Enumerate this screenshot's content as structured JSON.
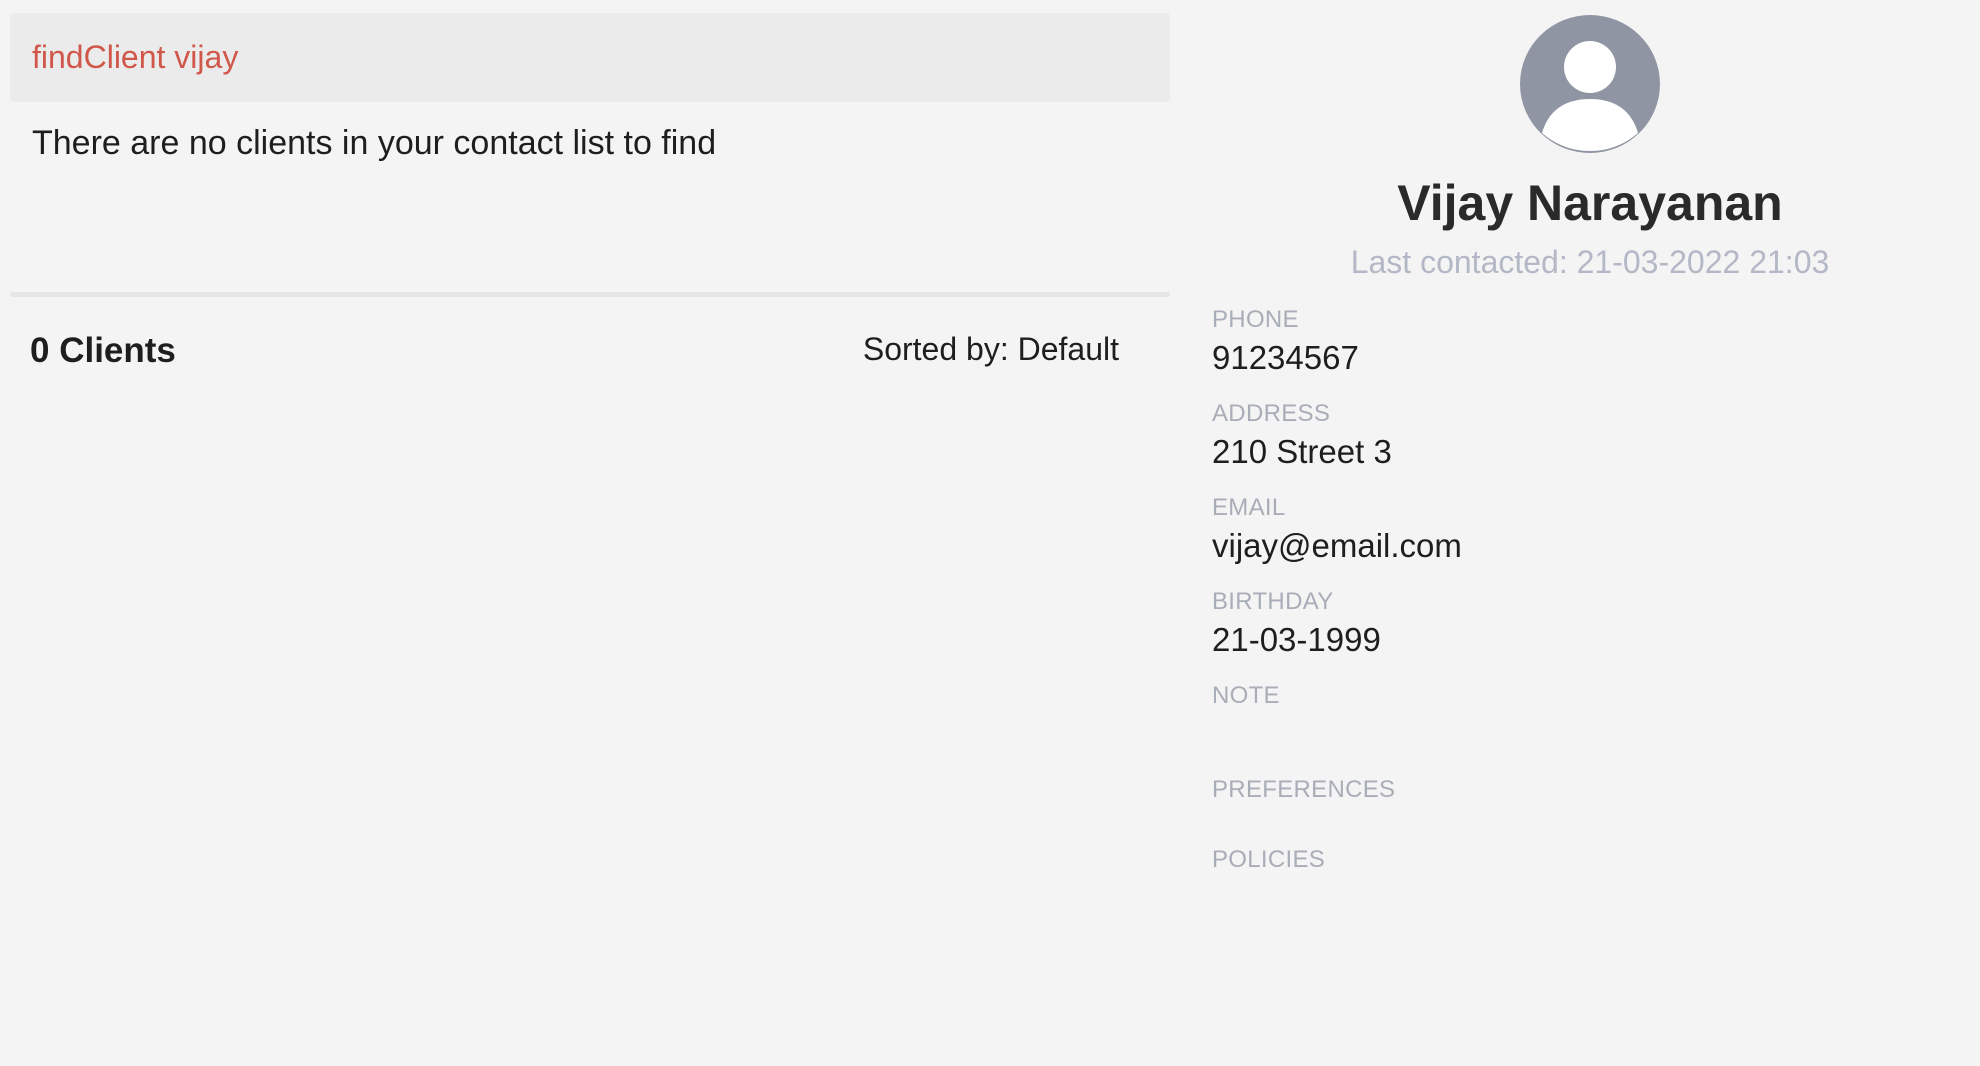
{
  "command": {
    "text": "findClient vijay"
  },
  "result": {
    "message": "There are no clients in your contact list to find"
  },
  "list": {
    "count_label": "0 Clients",
    "sort_label": "Sorted by: Default"
  },
  "profile": {
    "name": "Vijay Narayanan",
    "last_contacted": "Last contacted: 21-03-2022 21:03",
    "fields": [
      {
        "label": "PHONE",
        "value": "91234567"
      },
      {
        "label": "ADDRESS",
        "value": "210 Street 3"
      },
      {
        "label": "EMAIL",
        "value": "vijay@email.com"
      },
      {
        "label": "BIRTHDAY",
        "value": "21-03-1999"
      },
      {
        "label": "NOTE",
        "value": ""
      },
      {
        "label": "PREFERENCES",
        "value": ""
      },
      {
        "label": "POLICIES",
        "value": ""
      }
    ],
    "avatar_icon": "user-avatar-icon"
  },
  "colors": {
    "command_text": "#d0574a",
    "muted_text": "#b4b8c6",
    "avatar_bg": "#8f95a2",
    "background": "#f4f4f4"
  }
}
